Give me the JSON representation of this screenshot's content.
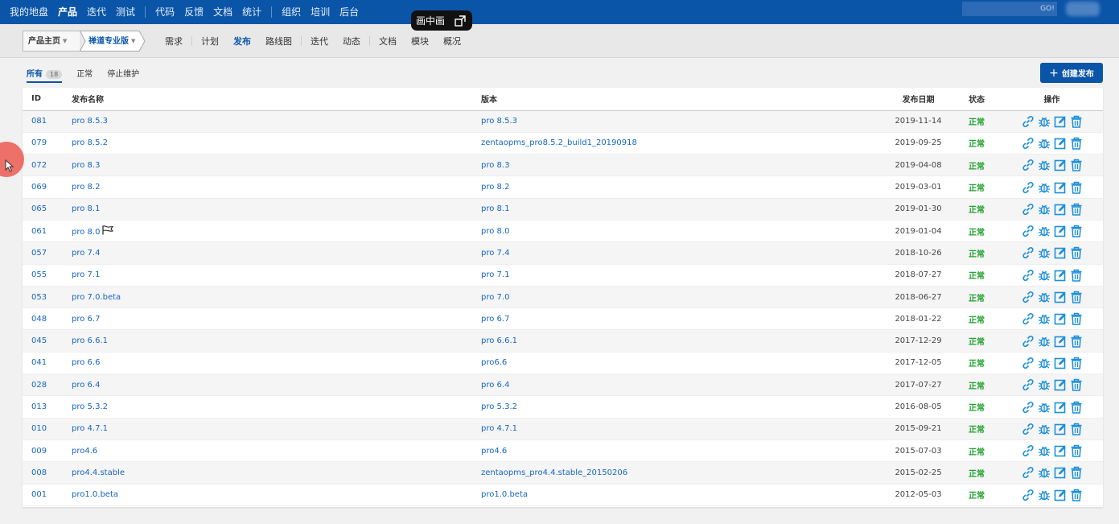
{
  "topnav": {
    "items": [
      {
        "label": "我的地盘",
        "active": false
      },
      {
        "label": "产品",
        "active": true
      },
      {
        "label": "迭代",
        "active": false
      },
      {
        "label": "测试",
        "active": false
      },
      {
        "label": "代码",
        "active": false
      },
      {
        "label": "反馈",
        "active": false
      },
      {
        "label": "文档",
        "active": false
      },
      {
        "label": "统计",
        "active": false
      },
      {
        "label": "组织",
        "active": false
      },
      {
        "label": "培训",
        "active": false
      },
      {
        "label": "后台",
        "active": false
      }
    ],
    "search_button": "GO!"
  },
  "pip": {
    "label": "画中画"
  },
  "breadcrumb": {
    "product_home": "产品主页",
    "current_product": "禅道专业版"
  },
  "subnav": {
    "items": [
      {
        "label": "需求",
        "active": false
      },
      {
        "label": "计划",
        "active": false
      },
      {
        "label": "发布",
        "active": true
      },
      {
        "label": "路线图",
        "active": false
      },
      {
        "label": "迭代",
        "active": false
      },
      {
        "label": "动态",
        "active": false
      },
      {
        "label": "文档",
        "active": false
      },
      {
        "label": "模块",
        "active": false
      },
      {
        "label": "概况",
        "active": false
      }
    ]
  },
  "filters": {
    "all_label": "所有",
    "all_count": "18",
    "normal_label": "正常",
    "stopped_label": "停止维护"
  },
  "create_button": "创建发布",
  "table": {
    "headers": {
      "id": "ID",
      "name": "发布名称",
      "version": "版本",
      "date": "发布日期",
      "status": "状态",
      "actions": "操作"
    },
    "rows": [
      {
        "id": "081",
        "name": "pro 8.5.3",
        "version": "pro 8.5.3",
        "date": "2019-11-14",
        "status": "正常",
        "flag": false
      },
      {
        "id": "079",
        "name": "pro 8.5.2",
        "version": "zentaopms_pro8.5.2_build1_20190918",
        "date": "2019-09-25",
        "status": "正常",
        "flag": false
      },
      {
        "id": "072",
        "name": "pro 8.3",
        "version": "pro 8.3",
        "date": "2019-04-08",
        "status": "正常",
        "flag": false
      },
      {
        "id": "069",
        "name": "pro 8.2",
        "version": "pro 8.2",
        "date": "2019-03-01",
        "status": "正常",
        "flag": false
      },
      {
        "id": "065",
        "name": "pro 8.1",
        "version": "pro 8.1",
        "date": "2019-01-30",
        "status": "正常",
        "flag": false
      },
      {
        "id": "061",
        "name": "pro 8.0",
        "version": "pro 8.0",
        "date": "2019-01-04",
        "status": "正常",
        "flag": true
      },
      {
        "id": "057",
        "name": "pro 7.4",
        "version": "pro 7.4",
        "date": "2018-10-26",
        "status": "正常",
        "flag": false
      },
      {
        "id": "055",
        "name": "pro 7.1",
        "version": "pro 7.1",
        "date": "2018-07-27",
        "status": "正常",
        "flag": false
      },
      {
        "id": "053",
        "name": "pro 7.0.beta",
        "version": "pro 7.0",
        "date": "2018-06-27",
        "status": "正常",
        "flag": false
      },
      {
        "id": "048",
        "name": "pro 6.7",
        "version": "pro 6.7",
        "date": "2018-01-22",
        "status": "正常",
        "flag": false
      },
      {
        "id": "045",
        "name": "pro 6.6.1",
        "version": "pro 6.6.1",
        "date": "2017-12-29",
        "status": "正常",
        "flag": false
      },
      {
        "id": "041",
        "name": "pro 6.6",
        "version": "pro6.6",
        "date": "2017-12-05",
        "status": "正常",
        "flag": false
      },
      {
        "id": "028",
        "name": "pro 6.4",
        "version": "pro 6.4",
        "date": "2017-07-27",
        "status": "正常",
        "flag": false
      },
      {
        "id": "013",
        "name": "pro 5.3.2",
        "version": "pro 5.3.2",
        "date": "2016-08-05",
        "status": "正常",
        "flag": false
      },
      {
        "id": "010",
        "name": "pro 4.7.1",
        "version": "pro 4.7.1",
        "date": "2015-09-21",
        "status": "正常",
        "flag": false
      },
      {
        "id": "009",
        "name": "pro4.6",
        "version": "pro4.6",
        "date": "2015-07-03",
        "status": "正常",
        "flag": false
      },
      {
        "id": "008",
        "name": "pro4.4.stable",
        "version": "zentaopms_pro4.4.stable_20150206",
        "date": "2015-02-25",
        "status": "正常",
        "flag": false
      },
      {
        "id": "001",
        "name": "pro1.0.beta",
        "version": "pro1.0.beta",
        "date": "2012-05-03",
        "status": "正常",
        "flag": false
      }
    ],
    "row_actions": [
      "link-icon",
      "bug-icon",
      "edit-icon",
      "delete-icon"
    ]
  },
  "colors": {
    "brand": "#0a55a8",
    "link": "#1666c0",
    "status_normal": "#22a32f",
    "action_icon": "#1b8fd8"
  }
}
